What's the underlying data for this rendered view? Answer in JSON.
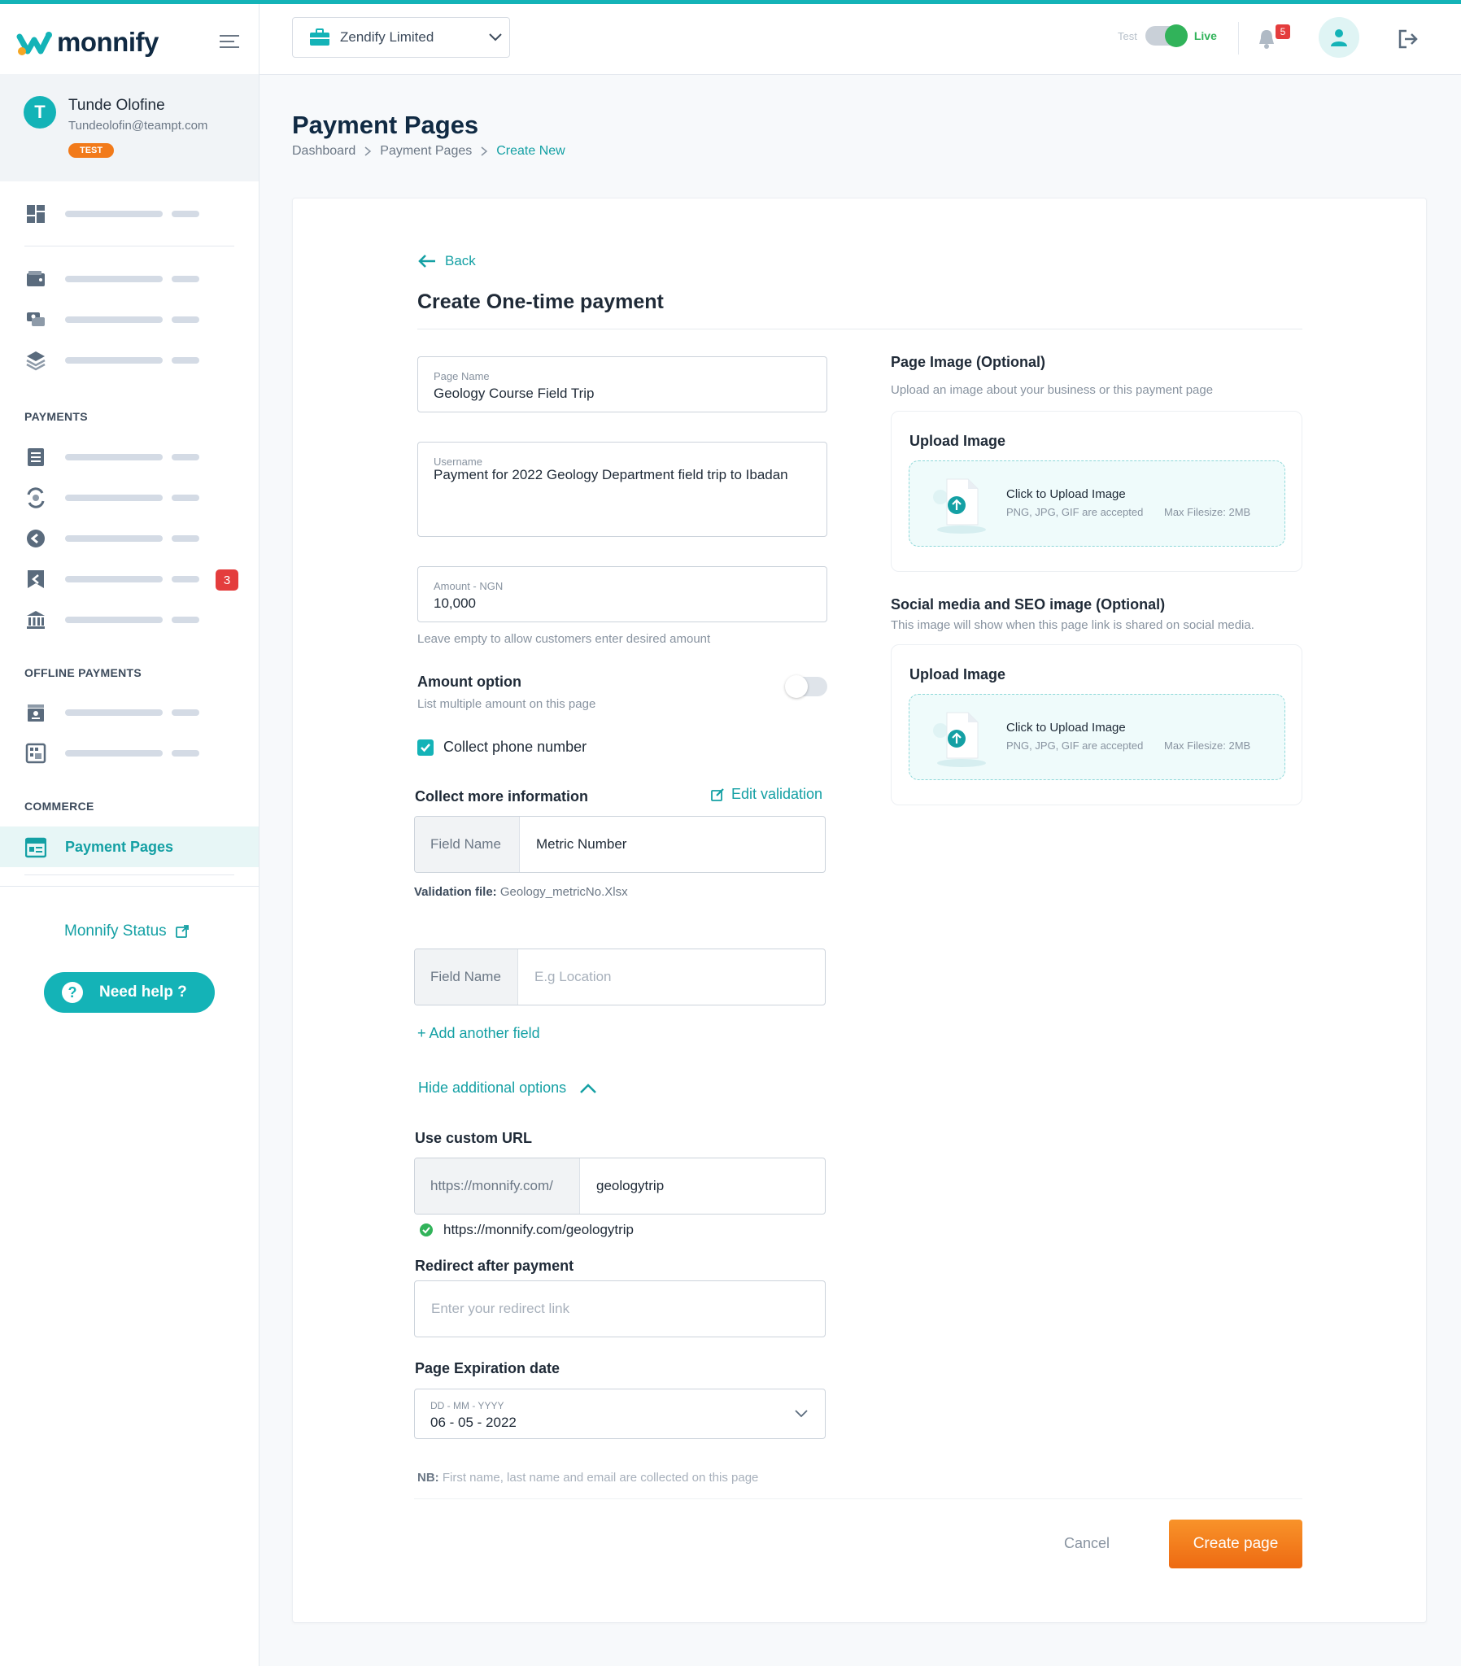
{
  "brand": {
    "name": "monnify"
  },
  "user": {
    "initial": "T",
    "name": "Tunde Olofine",
    "email": "Tundeolofin@teampt.com",
    "env_badge": "TEST"
  },
  "sidebar": {
    "sections": {
      "payments": "PAYMENTS",
      "offline": "OFFLINE PAYMENTS",
      "commerce": "COMMERCE"
    },
    "badge_count": "3",
    "active_item": "Payment Pages",
    "status_link": "Monnify Status",
    "help_button": "Need help ?"
  },
  "header": {
    "business": "Zendify Limited",
    "mode_test": "Test",
    "mode_live": "Live",
    "notifications": "5"
  },
  "page": {
    "title": "Payment Pages",
    "breadcrumb": [
      "Dashboard",
      "Payment Pages",
      "Create New"
    ]
  },
  "form": {
    "back": "Back",
    "title": "Create One-time payment",
    "page_name": {
      "label": "Page Name",
      "value": "Geology Course Field Trip"
    },
    "username": {
      "label": "Username",
      "value": "Payment for 2022 Geology Department field trip to Ibadan"
    },
    "amount": {
      "label": "Amount - NGN",
      "value": "10,000",
      "hint": "Leave empty to allow customers enter desired amount"
    },
    "amount_option": {
      "label": "Amount option",
      "hint": "List multiple amount on this page",
      "enabled": false
    },
    "collect_phone": {
      "label": "Collect phone number",
      "checked": true
    },
    "collect_more": {
      "label": "Collect more information",
      "edit_validation": "Edit validation"
    },
    "field1": {
      "prefix": "Field Name",
      "value": "Metric Number"
    },
    "validation_file": {
      "label": "Validation file:",
      "value": "Geology_metricNo.Xlsx"
    },
    "field2": {
      "prefix": "Field Name",
      "placeholder": "E.g Location"
    },
    "add_field": "+ Add another field",
    "hide_options": "Hide additional options",
    "custom_url": {
      "label": "Use custom URL",
      "prefix": "https://monnify.com/",
      "value": "geologytrip",
      "resolved": "https://monnify.com/geologytrip"
    },
    "redirect": {
      "label": "Redirect after payment",
      "placeholder": "Enter your redirect link"
    },
    "expiration": {
      "label": "Page Expiration date",
      "format": "DD - MM - YYYY",
      "value": "06 - 05 - 2022"
    },
    "nb": {
      "label": "NB:",
      "text": "First name, last name and email are collected on this page"
    },
    "cancel": "Cancel",
    "submit": "Create page"
  },
  "right": {
    "page_image": {
      "title": "Page Image (Optional)",
      "subtitle": "Upload an image about your business or this payment page"
    },
    "social_image": {
      "title": "Social media and SEO image (Optional)",
      "subtitle": "This image will show when this page link is shared on social media."
    },
    "upload": {
      "title": "Upload Image",
      "cta": "Click to Upload Image",
      "accepted": "PNG, JPG, GIF are accepted",
      "max": "Max Filesize: 2MB"
    }
  },
  "colors": {
    "accent": "#14b3b7",
    "primary_button": "#f27a1a",
    "live": "#31b35a",
    "badge": "#e43d3d"
  }
}
